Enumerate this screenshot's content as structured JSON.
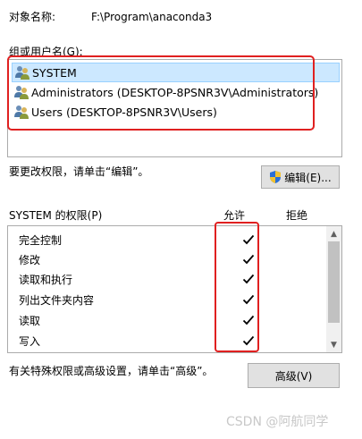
{
  "object": {
    "label": "对象名称:",
    "value": "F:\\Program\\anaconda3"
  },
  "groups": {
    "label": "组或用户名(G):",
    "items": [
      {
        "label": "SYSTEM",
        "selected": true
      },
      {
        "label": "Administrators (DESKTOP-8PSNR3V\\Administrators)",
        "selected": false
      },
      {
        "label": "Users (DESKTOP-8PSNR3V\\Users)",
        "selected": false
      }
    ]
  },
  "edit": {
    "hint": "要更改权限，请单击“编辑”。",
    "button_label": "编辑(E)..."
  },
  "permissions": {
    "header": "SYSTEM 的权限(P)",
    "allow_label": "允许",
    "deny_label": "拒绝",
    "rows": [
      {
        "name": "完全控制",
        "allow": true,
        "deny": false
      },
      {
        "name": "修改",
        "allow": true,
        "deny": false
      },
      {
        "name": "读取和执行",
        "allow": true,
        "deny": false
      },
      {
        "name": "列出文件夹内容",
        "allow": true,
        "deny": false
      },
      {
        "name": "读取",
        "allow": true,
        "deny": false
      },
      {
        "name": "写入",
        "allow": true,
        "deny": false
      }
    ]
  },
  "advanced": {
    "hint": "有关特殊权限或高级设置，请单击“高级”。",
    "button_label": "高级(V)"
  },
  "watermark": "CSDN @阿航同学",
  "colors": {
    "selection": "#cce8ff",
    "annotation": "#e02020",
    "button_bg": "#e1e1e1"
  }
}
